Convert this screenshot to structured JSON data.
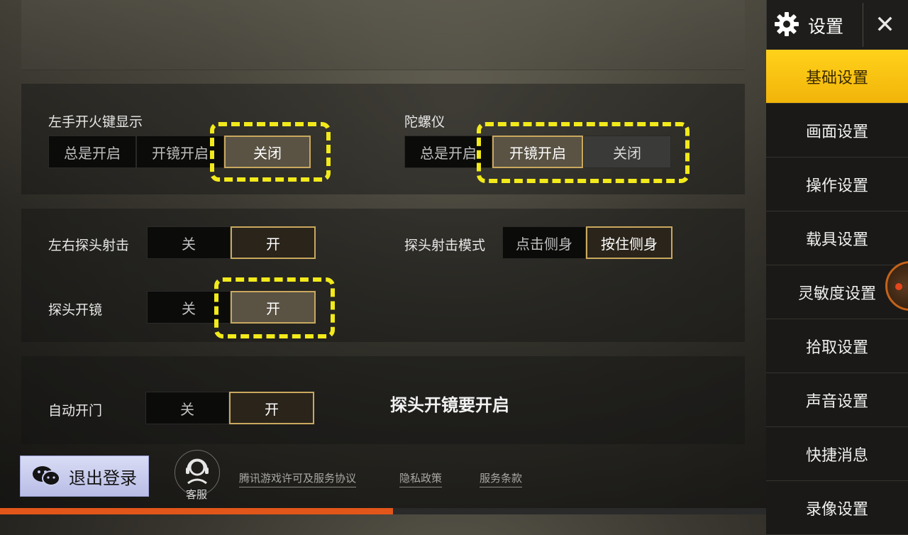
{
  "sidebar": {
    "title": "设置",
    "close_symbol": "✕",
    "items": [
      {
        "label": "基础设置",
        "active": true
      },
      {
        "label": "画面设置"
      },
      {
        "label": "操作设置"
      },
      {
        "label": "载具设置"
      },
      {
        "label": "灵敏度设置"
      },
      {
        "label": "拾取设置"
      },
      {
        "label": "声音设置"
      },
      {
        "label": "快捷消息"
      },
      {
        "label": "录像设置"
      }
    ]
  },
  "settings": {
    "left_fire_button": {
      "label": "左手开火键显示",
      "options": [
        "总是开启",
        "开镜开启",
        "关闭"
      ],
      "selected": "关闭"
    },
    "gyroscope": {
      "label": "陀螺仪",
      "options": [
        "总是开启",
        "开镜开启",
        "关闭"
      ],
      "selected": "开镜开启"
    },
    "peek_fire": {
      "label": "左右探头射击",
      "options": [
        "关",
        "开"
      ],
      "selected": "开"
    },
    "peek_mode": {
      "label": "探头射击模式",
      "options": [
        "点击侧身",
        "按住侧身"
      ],
      "selected": "按住侧身"
    },
    "peek_scope": {
      "label": "探头开镜",
      "options": [
        "关",
        "开"
      ],
      "selected": "开"
    },
    "auto_door": {
      "label": "自动开门",
      "options": [
        "关",
        "开"
      ],
      "selected": "开"
    }
  },
  "annotation": "探头开镜要开启",
  "footer": {
    "logout_label": "退出登录",
    "customer_service": "客服",
    "links": [
      "腾讯游戏许可及服务协议",
      "隐私政策",
      "服务条款"
    ]
  },
  "icons": {
    "gear": "gear-icon",
    "close": "close-icon",
    "wechat": "wechat-icon",
    "headset": "headset-icon"
  },
  "colors": {
    "accent_yellow": "#f2c20f",
    "highlight": "#f2ea1a",
    "selected_border": "#c9a85e",
    "progress": "#e2561a"
  },
  "video_progress": 0.513
}
